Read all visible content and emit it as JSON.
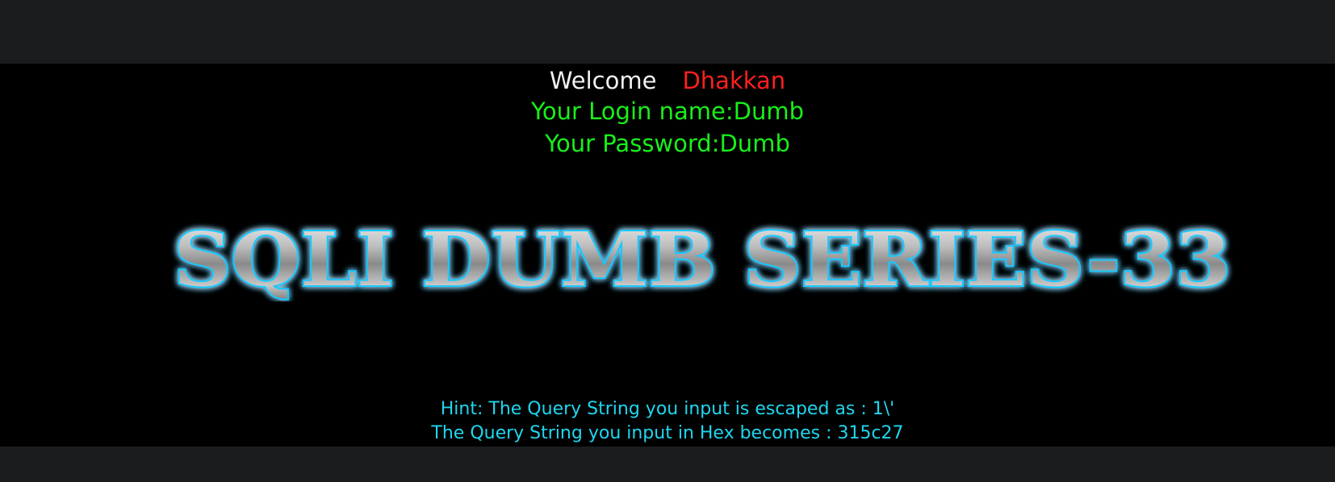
{
  "greeting": {
    "welcome": "Welcome",
    "user": "Dhakkan"
  },
  "credentials": {
    "login": "Your Login name:Dumb",
    "password": "Your Password:Dumb"
  },
  "banner": {
    "title": "SQLI DUMB SERIES-33"
  },
  "hints": {
    "escaped": "Hint: The Query String you input is escaped as : 1\\'",
    "hex": "The Query String you input in Hex becomes : 315c27"
  },
  "colors": {
    "welcome": "#f2f2f2",
    "user": "#ff1f1f",
    "credentials": "#19f019",
    "hints": "#1fd6ef",
    "banner_glow": "#18c8ff",
    "background": "#000000",
    "frame": "#1b1c1e"
  }
}
